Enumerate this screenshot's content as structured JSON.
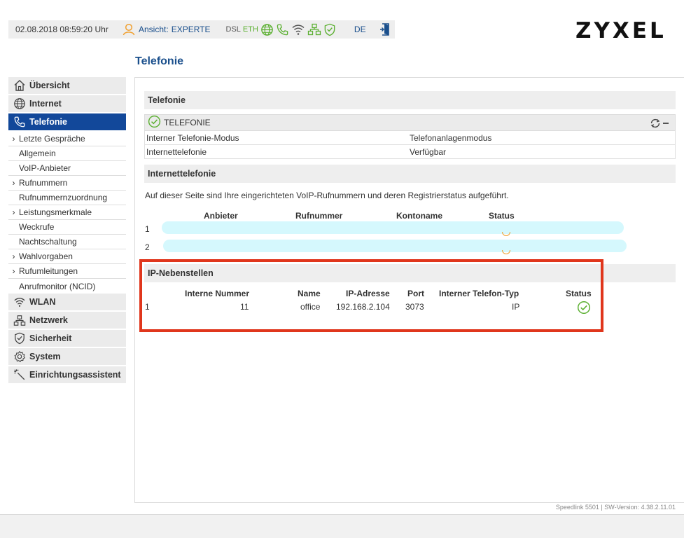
{
  "topbar": {
    "datetime": "02.08.2018 08:59:20 Uhr",
    "view_label": "Ansicht:",
    "view_value": "EXPERTE",
    "dsl_label": "DSL",
    "eth_label": "ETH",
    "language": "DE",
    "colors": {
      "ok_green": "#5cb032",
      "user_orange": "#f0a030",
      "link_blue": "#1a4f8c"
    }
  },
  "brand": {
    "logo_text": "ZYXEL"
  },
  "page": {
    "title": "Telefonie"
  },
  "sidebar": {
    "active_color": "#12489a",
    "main_items": [
      {
        "label": "Übersicht",
        "icon": "home-icon"
      },
      {
        "label": "Internet",
        "icon": "globe-icon"
      },
      {
        "label": "Telefonie",
        "icon": "phone-icon"
      }
    ],
    "sub_items": [
      {
        "label": "Letzte Gespräche",
        "expandable": true
      },
      {
        "label": "Allgemein",
        "expandable": false
      },
      {
        "label": "VoIP-Anbieter",
        "expandable": false
      },
      {
        "label": "Rufnummern",
        "expandable": true
      },
      {
        "label": "Rufnummernzuordnung",
        "expandable": false
      },
      {
        "label": "Leistungsmerkmale",
        "expandable": true
      },
      {
        "label": "Weckrufe",
        "expandable": false
      },
      {
        "label": "Nachtschaltung",
        "expandable": false
      },
      {
        "label": "Wahlvorgaben",
        "expandable": true
      },
      {
        "label": "Rufumleitungen",
        "expandable": true
      },
      {
        "label": "Anrufmonitor (NCID)",
        "expandable": false
      }
    ],
    "bottom_items": [
      {
        "label": "WLAN",
        "icon": "wifi-icon"
      },
      {
        "label": "Netzwerk",
        "icon": "network-icon"
      },
      {
        "label": "Sicherheit",
        "icon": "shield-icon"
      },
      {
        "label": "System",
        "icon": "gear-icon"
      },
      {
        "label": "Einrichtungsassistent",
        "icon": "wizard-icon"
      }
    ]
  },
  "telefonie_section": {
    "heading": "Telefonie",
    "panel_label": "TELEFONIE",
    "rows": [
      {
        "key": "Interner Telefonie-Modus",
        "value": "Telefonanlagenmodus"
      },
      {
        "key": "Internettelefonie",
        "value": "Verfügbar"
      }
    ]
  },
  "internet_section": {
    "heading": "Internettelefonie",
    "description": "Auf dieser Seite sind Ihre eingerichteten VoIP-Rufnummern und deren Registrierstatus aufgeführt.",
    "columns": [
      "Anbieter",
      "Rufnummer",
      "Kontoname",
      "Status"
    ],
    "rows": [
      {
        "index": "1"
      },
      {
        "index": "2"
      }
    ]
  },
  "ip_section": {
    "heading": "IP-Nebenstellen",
    "columns": [
      "Interne Nummer",
      "Name",
      "IP-Adresse",
      "Port",
      "Interner Telefon-Typ",
      "Status"
    ],
    "rows": [
      {
        "index": "1",
        "number": "11",
        "name": "office",
        "ip": "192.168.2.104",
        "port": "3073",
        "type": "IP",
        "status_icon": "check-circle-icon"
      }
    ]
  },
  "footer": {
    "version": "Speedlink 5501 | SW-Version: 4.38.2.11.01"
  }
}
